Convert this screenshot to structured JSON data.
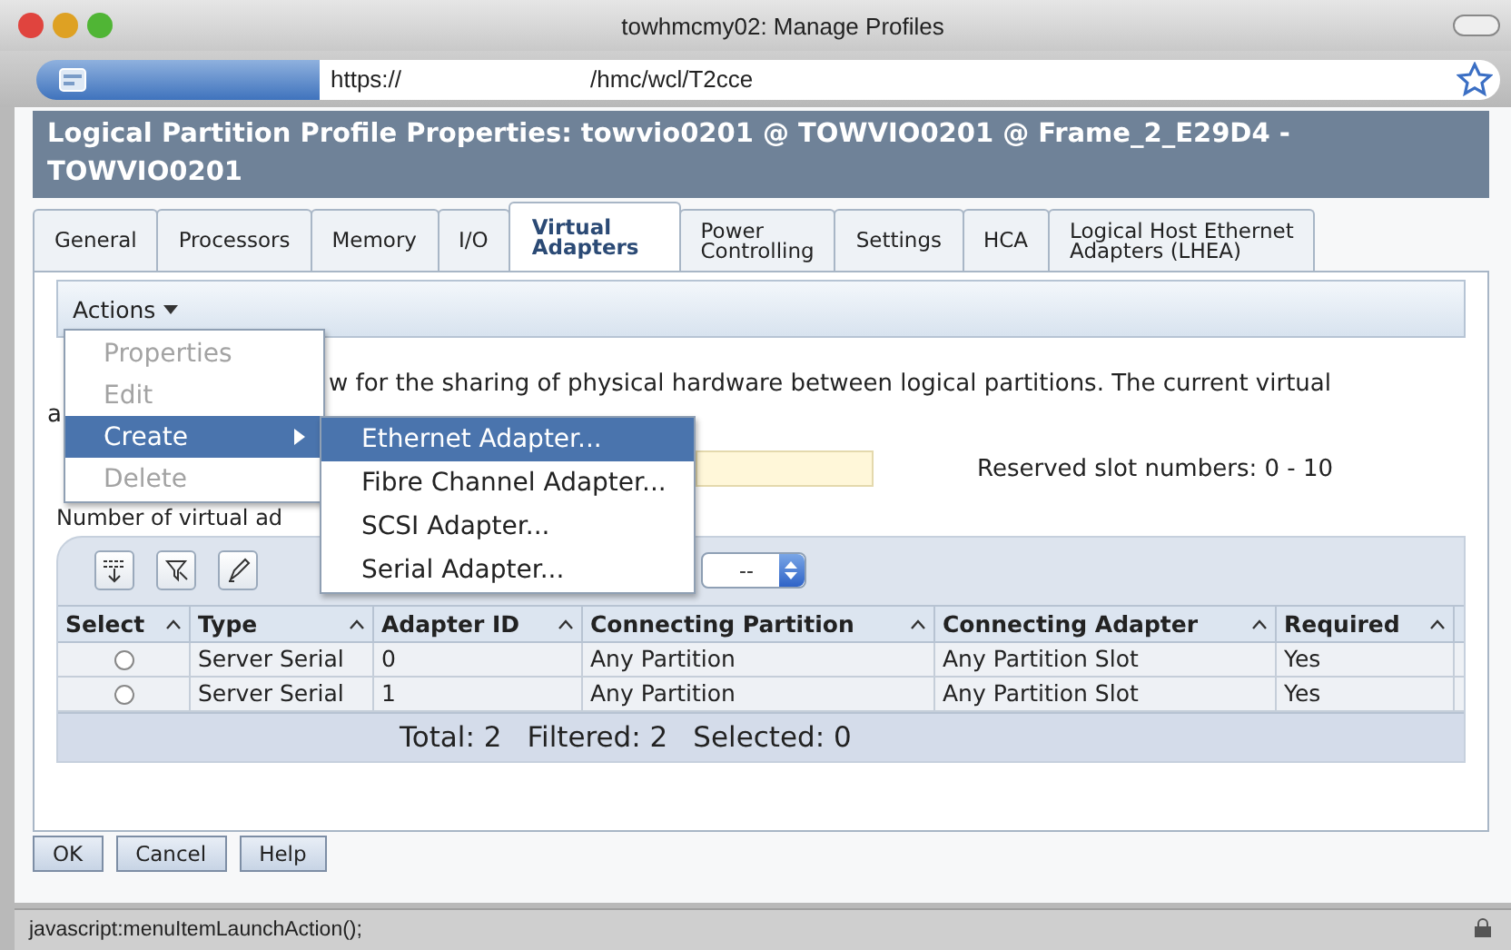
{
  "window": {
    "title": "towhmcmy02: Manage Profiles"
  },
  "address_bar": {
    "scheme": "https://",
    "path": "/hmc/wcl/T2cce"
  },
  "page_title": "Logical Partition Profile Properties: towvio0201 @ TOWVIO0201 @ Frame_2_E29D4 - TOWVIO0201",
  "tabs": [
    {
      "label": "General",
      "selected": false
    },
    {
      "label": "Processors",
      "selected": false
    },
    {
      "label": "Memory",
      "selected": false
    },
    {
      "label": "I/O",
      "selected": false
    },
    {
      "label": "Virtual\nAdapters",
      "selected": true
    },
    {
      "label": "Power\nControlling",
      "selected": false
    },
    {
      "label": "Settings",
      "selected": false
    },
    {
      "label": "HCA",
      "selected": false
    },
    {
      "label": "Logical Host Ethernet\nAdapters (LHEA)",
      "selected": false
    }
  ],
  "actions_menu": {
    "label": "Actions",
    "items": [
      {
        "label": "Properties",
        "disabled": true,
        "selected": false,
        "has_submenu": false
      },
      {
        "label": "Edit",
        "disabled": true,
        "selected": false,
        "has_submenu": false
      },
      {
        "label": "Create",
        "disabled": false,
        "selected": true,
        "has_submenu": true
      },
      {
        "label": "Delete",
        "disabled": true,
        "selected": false,
        "has_submenu": false
      }
    ]
  },
  "create_submenu": [
    {
      "label": "Ethernet Adapter...",
      "selected": true
    },
    {
      "label": "Fibre Channel Adapter...",
      "selected": false
    },
    {
      "label": "SCSI Adapter...",
      "selected": false
    },
    {
      "label": "Serial Adapter...",
      "selected": false
    }
  ],
  "description": "w for the sharing of physical hardware between logical partitions. The current virtual",
  "description_line_2": "a",
  "reserved_slots": "Reserved slot numbers: 0 - 10",
  "number_label": "Number of virtual ad",
  "filter_select": {
    "value": "--"
  },
  "table": {
    "columns": [
      "Select",
      "Type",
      "Adapter ID",
      "Connecting Partition",
      "Connecting Adapter",
      "Required"
    ],
    "rows": [
      {
        "selected": false,
        "cells": [
          "",
          "Server Serial",
          "0",
          "Any Partition",
          "Any Partition Slot",
          "Yes"
        ]
      },
      {
        "selected": false,
        "cells": [
          "",
          "Server Serial",
          "1",
          "Any Partition",
          "Any Partition Slot",
          "Yes"
        ]
      }
    ],
    "footer": [
      "Total: 2",
      "Filtered: 2",
      "Selected: 0"
    ]
  },
  "buttons": [
    "OK",
    "Cancel",
    "Help"
  ],
  "status_bar": "javascript:menuItemLaunchAction();"
}
